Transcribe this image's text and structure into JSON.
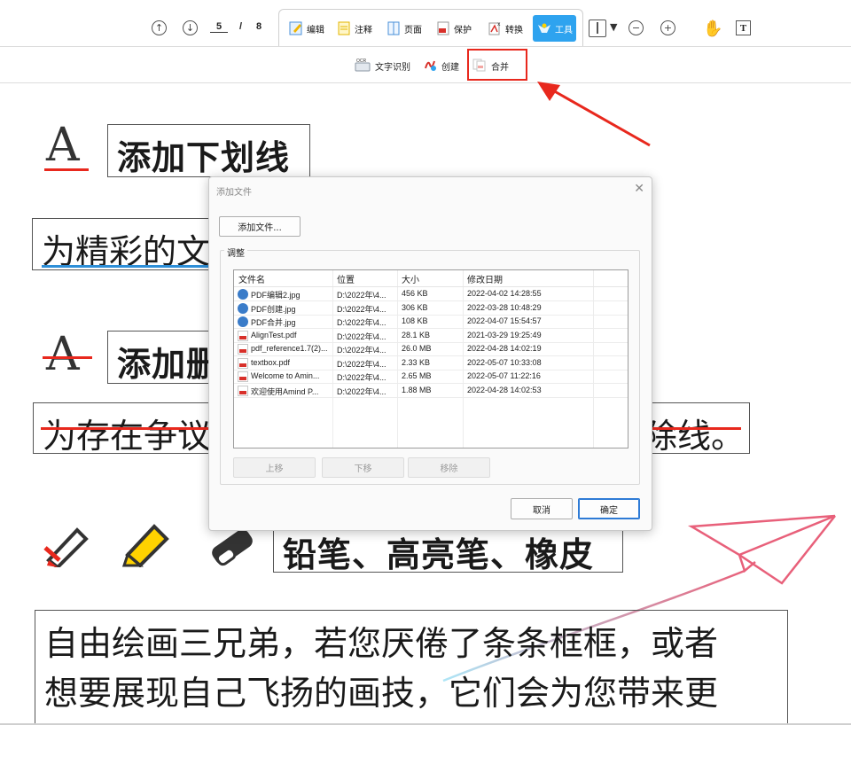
{
  "toolbar": {
    "page_current": "5",
    "page_separator": "/",
    "page_total": "8",
    "tabs": [
      {
        "label": "编辑",
        "icon": "edit-icon"
      },
      {
        "label": "注释",
        "icon": "note-icon"
      },
      {
        "label": "页面",
        "icon": "page-icon"
      },
      {
        "label": "保护",
        "icon": "protect-icon"
      },
      {
        "label": "转换",
        "icon": "convert-icon"
      },
      {
        "label": "工具",
        "icon": "tools-icon",
        "active": true
      }
    ],
    "accent_color": "#2ea3ef"
  },
  "subtoolbar": {
    "items": [
      {
        "label": "文字识别",
        "icon": "ocr-icon"
      },
      {
        "label": "创建",
        "icon": "create-pdf-icon"
      },
      {
        "label": "合并",
        "icon": "merge-icon"
      }
    ],
    "highlight_color": "#e8281d"
  },
  "document": {
    "underline_heading": "添加下划线",
    "underline_sample": "为精彩的文",
    "strike_heading": "添加删",
    "strike_sample_left": "为存在争议",
    "strike_sample_right": "除线。",
    "pencil_heading": "铅笔、高亮笔、橡皮",
    "paragraph_line1": "自由绘画三兄弟，若您厌倦了条条框框，或者",
    "paragraph_line2": "想要展现自己飞扬的画技，它们会为您带来更"
  },
  "dialog": {
    "title": "添加文件",
    "add_file_button": "添加文件...",
    "group_label": "调整",
    "columns": [
      "文件名",
      "位置",
      "大小",
      "修改日期"
    ],
    "files": [
      {
        "name": "PDF编辑2.jpg",
        "type": "jpg",
        "location": "D:\\2022年\\4...",
        "size": "456 KB",
        "modified": "2022-04-02 14:28:55"
      },
      {
        "name": "PDF创建.jpg",
        "type": "jpg",
        "location": "D:\\2022年\\4...",
        "size": "306 KB",
        "modified": "2022-03-28 10:48:29"
      },
      {
        "name": "PDF合并.jpg",
        "type": "jpg",
        "location": "D:\\2022年\\4...",
        "size": "108 KB",
        "modified": "2022-04-07 15:54:57"
      },
      {
        "name": "AlignTest.pdf",
        "type": "pdf",
        "location": "D:\\2022年\\4...",
        "size": "28.1 KB",
        "modified": "2021-03-29 19:25:49"
      },
      {
        "name": "pdf_reference1.7(2)...",
        "type": "pdf",
        "location": "D:\\2022年\\4...",
        "size": "26.0 MB",
        "modified": "2022-04-28 14:02:19"
      },
      {
        "name": "textbox.pdf",
        "type": "pdf",
        "location": "D:\\2022年\\4...",
        "size": "2.33 KB",
        "modified": "2022-05-07 10:33:08"
      },
      {
        "name": "Welcome to Amin...",
        "type": "pdf",
        "location": "D:\\2022年\\4...",
        "size": "2.65 MB",
        "modified": "2022-05-07 11:22:16"
      },
      {
        "name": "欢迎使用Amind P...",
        "type": "pdf",
        "location": "D:\\2022年\\4...",
        "size": "1.88 MB",
        "modified": "2022-04-28 14:02:53"
      }
    ],
    "move_up": "上移",
    "move_down": "下移",
    "remove": "移除",
    "cancel": "取消",
    "confirm": "确定"
  }
}
